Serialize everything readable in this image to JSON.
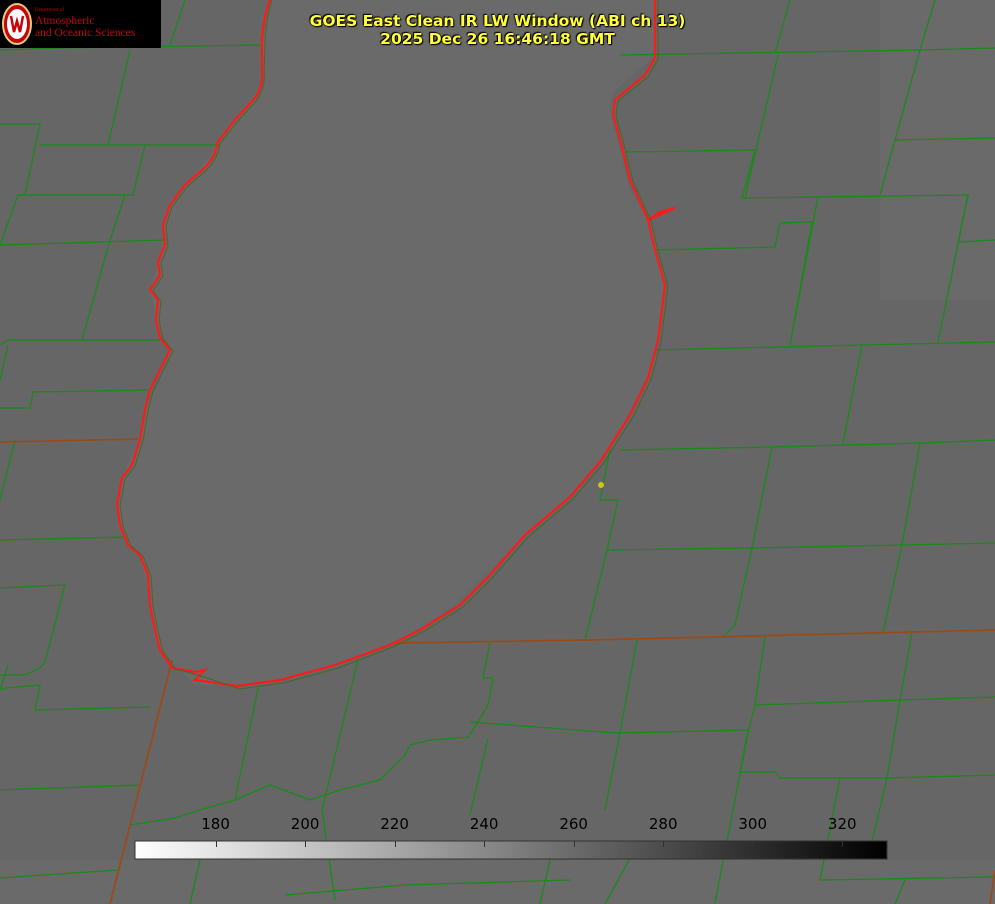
{
  "logo": {
    "department": "Department of",
    "line1": "Atmospheric",
    "line2": "and Oceanic Sciences",
    "seal_letter": "W",
    "color": "#c5050c"
  },
  "title": {
    "line1": "GOES East Clean IR LW Window (ABI ch 13)",
    "line2": "2025 Dec 26 16:46:18 GMT",
    "color": "#ffff3a"
  },
  "colorbar": {
    "min": 162,
    "max": 330,
    "ticks": [
      180,
      200,
      220,
      240,
      260,
      280,
      300,
      320
    ],
    "gradient": [
      "#ffffff",
      "#000000"
    ]
  },
  "map": {
    "background": "#666666",
    "lake_color": "#6a6a6a",
    "shoreline_color": "#ff1a1a",
    "county_color": "#1a8a1a",
    "marker_color": "#d4c01e",
    "icons": [
      "university-seal-icon",
      "city-marker-icon"
    ]
  }
}
